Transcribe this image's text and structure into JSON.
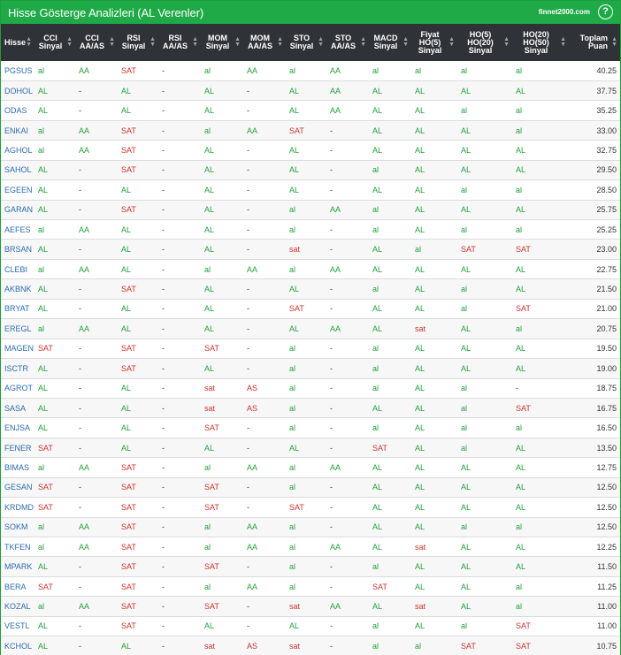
{
  "window": {
    "title": "Hisse Gösterge Analizleri (AL Verenler)",
    "brand": "finnet2000.com",
    "help": "?"
  },
  "colors": {
    "header_bar": "#1faa47",
    "table_header": "#2f3338",
    "positive": "#22a03a",
    "negative": "#d0312d",
    "code": "#2b6cb0"
  },
  "columns": [
    [
      "Hisse"
    ],
    [
      "CCI",
      "Sinyal"
    ],
    [
      "CCI",
      "AA/AS"
    ],
    [
      "RSI",
      "Sinyal"
    ],
    [
      "RSI",
      "AA/AS"
    ],
    [
      "MOM",
      "Sinyal"
    ],
    [
      "MOM",
      "AA/AS"
    ],
    [
      "STO",
      "Sinyal"
    ],
    [
      "STO",
      "AA/AS"
    ],
    [
      "MACD",
      "Sinyal"
    ],
    [
      "Fiyat",
      "HO(5)",
      "Sinyal"
    ],
    [
      "HO(5)",
      "HO(20)",
      "Sinyal"
    ],
    [
      "HO(20)",
      "HO(50)",
      "Sinyal"
    ],
    [
      "Toplam",
      "Puan"
    ]
  ],
  "rows": [
    [
      "PGSUS",
      "al",
      "AA",
      "SAT",
      "-",
      "al",
      "AA",
      "al",
      "AA",
      "al",
      "al",
      "al",
      "al",
      "40.25"
    ],
    [
      "DOHOL",
      "AL",
      "-",
      "AL",
      "-",
      "AL",
      "-",
      "AL",
      "AA",
      "AL",
      "AL",
      "AL",
      "AL",
      "37.75"
    ],
    [
      "ODAS",
      "AL",
      "-",
      "AL",
      "-",
      "AL",
      "-",
      "AL",
      "AA",
      "AL",
      "AL",
      "al",
      "al",
      "35.25"
    ],
    [
      "ENKAI",
      "al",
      "AA",
      "SAT",
      "-",
      "al",
      "AA",
      "SAT",
      "-",
      "AL",
      "AL",
      "AL",
      "al",
      "33.00"
    ],
    [
      "AGHOL",
      "al",
      "AA",
      "SAT",
      "-",
      "AL",
      "-",
      "AL",
      "-",
      "AL",
      "AL",
      "AL",
      "AL",
      "32.75"
    ],
    [
      "SAHOL",
      "AL",
      "-",
      "SAT",
      "-",
      "AL",
      "-",
      "AL",
      "-",
      "al",
      "AL",
      "AL",
      "AL",
      "29.50"
    ],
    [
      "EGEEN",
      "AL",
      "-",
      "AL",
      "-",
      "AL",
      "-",
      "AL",
      "-",
      "AL",
      "AL",
      "al",
      "al",
      "28.50"
    ],
    [
      "GARAN",
      "AL",
      "-",
      "SAT",
      "-",
      "AL",
      "-",
      "al",
      "AA",
      "al",
      "AL",
      "AL",
      "AL",
      "25.75"
    ],
    [
      "AEFES",
      "al",
      "AA",
      "AL",
      "-",
      "AL",
      "-",
      "al",
      "-",
      "al",
      "AL",
      "al",
      "al",
      "25.25"
    ],
    [
      "BRSAN",
      "AL",
      "-",
      "AL",
      "-",
      "AL",
      "-",
      "sat",
      "-",
      "AL",
      "al",
      "SAT",
      "SAT",
      "23.00"
    ],
    [
      "CLEBI",
      "al",
      "AA",
      "AL",
      "-",
      "al",
      "AA",
      "al",
      "AA",
      "AL",
      "AL",
      "AL",
      "AL",
      "22.75"
    ],
    [
      "AKBNK",
      "AL",
      "-",
      "SAT",
      "-",
      "AL",
      "-",
      "AL",
      "-",
      "al",
      "AL",
      "al",
      "AL",
      "21.50"
    ],
    [
      "BRYAT",
      "AL",
      "-",
      "AL",
      "-",
      "AL",
      "-",
      "SAT",
      "-",
      "AL",
      "AL",
      "al",
      "SAT",
      "21.00"
    ],
    [
      "EREGL",
      "al",
      "AA",
      "AL",
      "-",
      "AL",
      "-",
      "AL",
      "AA",
      "AL",
      "sat",
      "AL",
      "al",
      "20.75"
    ],
    [
      "MAGEN",
      "SAT",
      "-",
      "SAT",
      "-",
      "SAT",
      "-",
      "al",
      "-",
      "al",
      "AL",
      "AL",
      "AL",
      "19.50"
    ],
    [
      "ISCTR",
      "AL",
      "-",
      "SAT",
      "-",
      "AL",
      "-",
      "al",
      "-",
      "al",
      "AL",
      "AL",
      "AL",
      "19.00"
    ],
    [
      "AGROT",
      "AL",
      "-",
      "AL",
      "-",
      "sat",
      "AS",
      "al",
      "-",
      "al",
      "AL",
      "al",
      "-",
      "18.75"
    ],
    [
      "SASA",
      "AL",
      "-",
      "AL",
      "-",
      "sat",
      "AS",
      "al",
      "-",
      "AL",
      "AL",
      "al",
      "SAT",
      "16.75"
    ],
    [
      "ENJSA",
      "AL",
      "-",
      "AL",
      "-",
      "SAT",
      "-",
      "al",
      "-",
      "al",
      "AL",
      "al",
      "al",
      "16.50"
    ],
    [
      "FENER",
      "SAT",
      "-",
      "AL",
      "-",
      "AL",
      "-",
      "AL",
      "-",
      "SAT",
      "AL",
      "al",
      "AL",
      "13.50"
    ],
    [
      "BIMAS",
      "al",
      "AA",
      "SAT",
      "-",
      "al",
      "AA",
      "al",
      "AA",
      "AL",
      "AL",
      "AL",
      "AL",
      "12.75"
    ],
    [
      "GESAN",
      "SAT",
      "-",
      "SAT",
      "-",
      "SAT",
      "-",
      "al",
      "-",
      "AL",
      "AL",
      "AL",
      "AL",
      "12.50"
    ],
    [
      "KRDMD",
      "SAT",
      "-",
      "SAT",
      "-",
      "SAT",
      "-",
      "SAT",
      "-",
      "AL",
      "AL",
      "AL",
      "AL",
      "12.50"
    ],
    [
      "SOKM",
      "al",
      "AA",
      "SAT",
      "-",
      "al",
      "AA",
      "al",
      "-",
      "AL",
      "AL",
      "al",
      "al",
      "12.50"
    ],
    [
      "TKFEN",
      "al",
      "AA",
      "SAT",
      "-",
      "al",
      "AA",
      "al",
      "AA",
      "AL",
      "sat",
      "AL",
      "AL",
      "12.25"
    ],
    [
      "MPARK",
      "AL",
      "-",
      "SAT",
      "-",
      "SAT",
      "-",
      "al",
      "-",
      "al",
      "AL",
      "AL",
      "AL",
      "11.50"
    ],
    [
      "BERA",
      "SAT",
      "-",
      "SAT",
      "-",
      "al",
      "AA",
      "al",
      "-",
      "SAT",
      "AL",
      "AL",
      "al",
      "11.25"
    ],
    [
      "KOZAL",
      "al",
      "AA",
      "SAT",
      "-",
      "SAT",
      "-",
      "sat",
      "AA",
      "AL",
      "sat",
      "AL",
      "al",
      "11.00"
    ],
    [
      "VESTL",
      "AL",
      "-",
      "SAT",
      "-",
      "AL",
      "-",
      "AL",
      "-",
      "al",
      "AL",
      "al",
      "SAT",
      "11.00"
    ],
    [
      "KCHOL",
      "AL",
      "-",
      "AL",
      "-",
      "sat",
      "AS",
      "sat",
      "-",
      "al",
      "al",
      "SAT",
      "SAT",
      "10.75"
    ]
  ]
}
